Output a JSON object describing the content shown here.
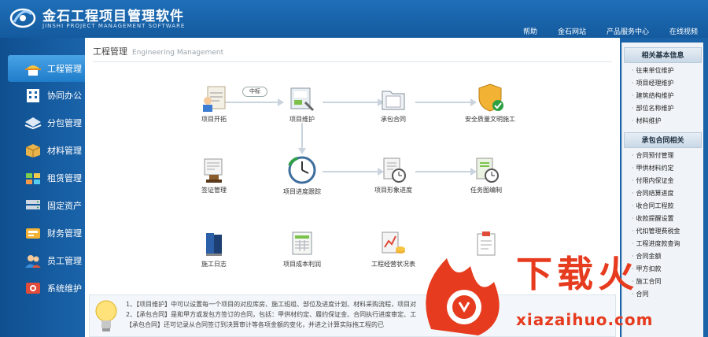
{
  "header": {
    "app_title": "金石工程项目管理软件",
    "app_subtitle": "JINSHI PROJECT MANAGEMENT SOFTWARE",
    "links": [
      "帮助",
      "金石网站",
      "产品服务中心",
      "在线视频"
    ]
  },
  "sidebar": {
    "items": [
      {
        "label": "工程管理",
        "icon": "construction-worker-icon",
        "active": true
      },
      {
        "label": "协同办公",
        "icon": "office-building-icon"
      },
      {
        "label": "分包管理",
        "icon": "handshake-icon"
      },
      {
        "label": "材料管理",
        "icon": "box-icon"
      },
      {
        "label": "租赁管理",
        "icon": "rental-icon"
      },
      {
        "label": "固定资产",
        "icon": "server-icon"
      },
      {
        "label": "财务管理",
        "icon": "finance-icon"
      },
      {
        "label": "员工管理",
        "icon": "staff-icon"
      },
      {
        "label": "系统维护",
        "icon": "settings-icon"
      }
    ]
  },
  "main": {
    "title": "工程管理",
    "title_en": "Engineering Management",
    "badge_label": "中标",
    "nodes": {
      "project_start": "项目开拓",
      "project_maintain": "项目维护",
      "subcontract": "承包合同",
      "safety": "安全质量文明施工",
      "visa": "签证管理",
      "schedule": "项目进度跟踪",
      "image_progress": "项目形象进度",
      "task_plan": "任务图编制",
      "construction_log": "施工日志",
      "cost": "项目成本利润",
      "operation": "工程经营状况表",
      "report": ""
    },
    "tips": [
      "1、【项目维护】中可以设置每一个项目的对应库房、施工班组、部位及进度计划、材料采购流程，项目对",
      "2、【承包合同】是和甲方或发包方签订的合同，包括：甲供材约定、履约保证金、合同执行进度审定、工",
      "【承包合同】还可记录从合同签订到决算审计等各项金额的变化，并进之计算实际拖工程的已"
    ]
  },
  "right_panel": {
    "section1": {
      "title": "相关基本信息",
      "items": [
        "往来单位维护",
        "项目经理维护",
        "建筑结构维护",
        "部位名称维护",
        "材料维护"
      ]
    },
    "section2": {
      "title": "承包合同相关",
      "items": [
        "合同预付管理",
        "甲供材料约定",
        "付限内保证金",
        "合同结算进度",
        "收合同工程款",
        "收款提醒设置",
        "代扣管理费税金",
        "工程进度款查询",
        "合同金额",
        "甲方扣款",
        "施工合同",
        "合同"
      ]
    }
  },
  "watermark": {
    "text": "下载火",
    "url": "xiazaihuo.com"
  }
}
